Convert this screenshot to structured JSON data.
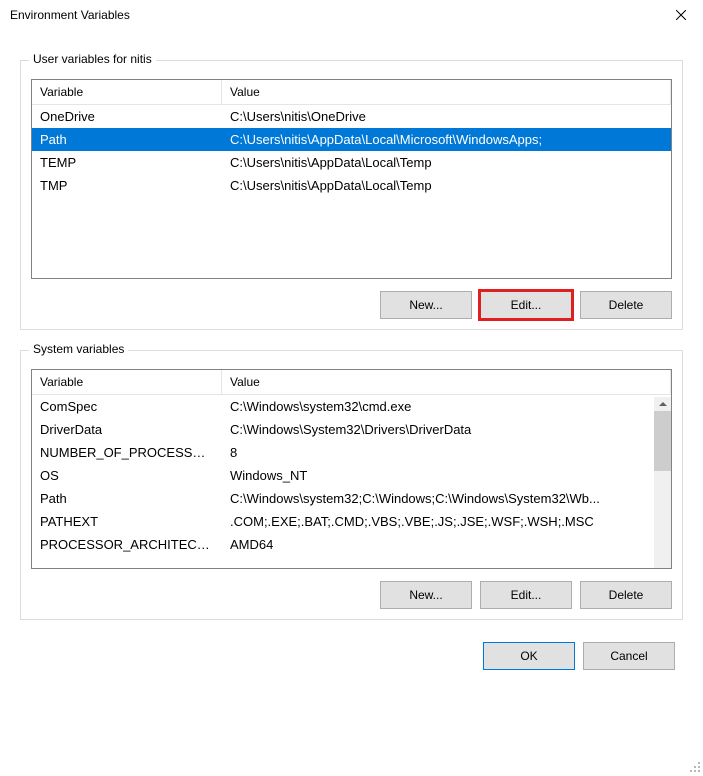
{
  "window": {
    "title": "Environment Variables"
  },
  "userSection": {
    "label": "User variables for nitis",
    "columns": {
      "variable": "Variable",
      "value": "Value"
    },
    "rows": [
      {
        "variable": "OneDrive",
        "value": "C:\\Users\\nitis\\OneDrive",
        "selected": false
      },
      {
        "variable": "Path",
        "value": "C:\\Users\\nitis\\AppData\\Local\\Microsoft\\WindowsApps;",
        "selected": true
      },
      {
        "variable": "TEMP",
        "value": "C:\\Users\\nitis\\AppData\\Local\\Temp",
        "selected": false
      },
      {
        "variable": "TMP",
        "value": "C:\\Users\\nitis\\AppData\\Local\\Temp",
        "selected": false
      }
    ],
    "buttons": {
      "new": "New...",
      "edit": "Edit...",
      "delete": "Delete"
    }
  },
  "systemSection": {
    "label": "System variables",
    "columns": {
      "variable": "Variable",
      "value": "Value"
    },
    "rows": [
      {
        "variable": "ComSpec",
        "value": "C:\\Windows\\system32\\cmd.exe"
      },
      {
        "variable": "DriverData",
        "value": "C:\\Windows\\System32\\Drivers\\DriverData"
      },
      {
        "variable": "NUMBER_OF_PROCESSORS",
        "value": "8"
      },
      {
        "variable": "OS",
        "value": "Windows_NT"
      },
      {
        "variable": "Path",
        "value": "C:\\Windows\\system32;C:\\Windows;C:\\Windows\\System32\\Wb..."
      },
      {
        "variable": "PATHEXT",
        "value": ".COM;.EXE;.BAT;.CMD;.VBS;.VBE;.JS;.JSE;.WSF;.WSH;.MSC"
      },
      {
        "variable": "PROCESSOR_ARCHITECTU...",
        "value": "AMD64"
      }
    ],
    "buttons": {
      "new": "New...",
      "edit": "Edit...",
      "delete": "Delete"
    }
  },
  "dialogButtons": {
    "ok": "OK",
    "cancel": "Cancel"
  }
}
